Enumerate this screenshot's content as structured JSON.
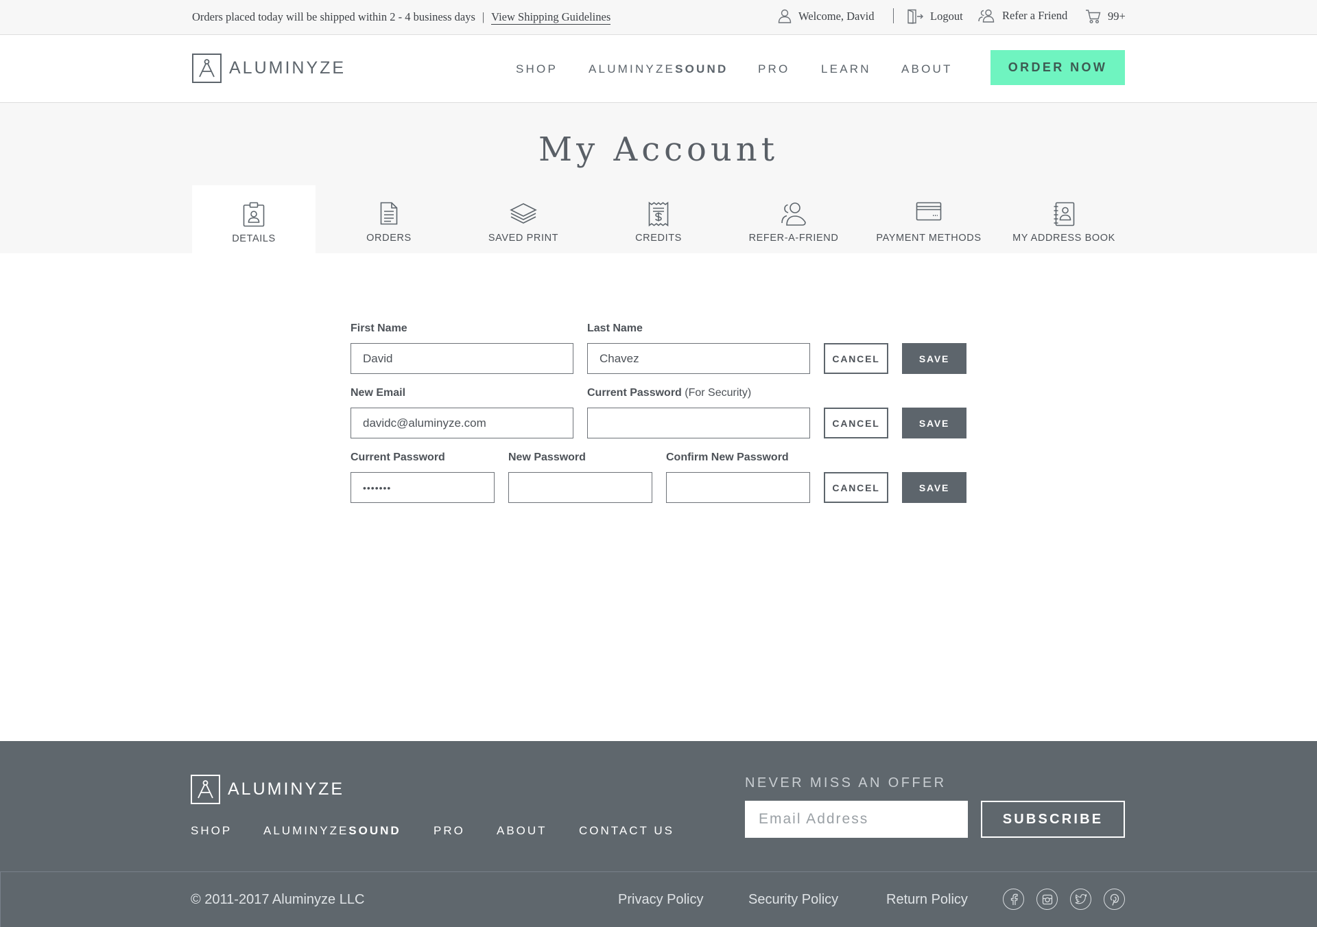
{
  "topbar": {
    "shipping_message": "Orders placed today will be shipped within 2 - 4 business days",
    "separator": "|",
    "shipping_link": "View Shipping Guidelines",
    "welcome": "Welcome, David",
    "logout": "Logout",
    "refer": "Refer a Friend",
    "cart_count": "99+"
  },
  "header": {
    "logo_text": "ALUMINYZE",
    "nav": {
      "shop": "SHOP",
      "sound_prefix": "ALUMINYZE",
      "sound_suffix": "SOUND",
      "pro": "PRO",
      "learn": "LEARN",
      "about": "ABOUT"
    },
    "order_now": "ORDER NOW",
    "accent_color": "#6ff4c0"
  },
  "page": {
    "title": "My Account"
  },
  "tabs": [
    {
      "label": "DETAILS",
      "icon": "id-badge-icon",
      "active": true
    },
    {
      "label": "ORDERS",
      "icon": "document-icon",
      "active": false
    },
    {
      "label": "SAVED PRINT",
      "icon": "layers-icon",
      "active": false
    },
    {
      "label": "CREDITS",
      "icon": "receipt-dollar-icon",
      "active": false
    },
    {
      "label": "REFER-A-FRIEND",
      "icon": "users-icon",
      "active": false
    },
    {
      "label": "PAYMENT METHODS",
      "icon": "credit-card-icon",
      "active": false
    },
    {
      "label": "MY ADDRESS BOOK",
      "icon": "address-book-icon",
      "active": false
    }
  ],
  "form": {
    "name_row": {
      "first_label": "First Name",
      "first_value": "David",
      "last_label": "Last Name",
      "last_value": "Chavez"
    },
    "email_row": {
      "email_label": "New Email",
      "email_value": "davidc@aluminyze.com",
      "password_label": "Current Password",
      "password_note": "(For Security)",
      "password_value": ""
    },
    "password_row": {
      "current_label": "Current Password",
      "current_value": "•••••••",
      "new_label": "New Password",
      "new_value": "",
      "confirm_label": "Confirm New Password",
      "confirm_value": ""
    },
    "cancel_label": "CANCEL",
    "save_label": "SAVE"
  },
  "footer": {
    "logo_text": "ALUMINYZE",
    "nav": {
      "shop": "SHOP",
      "sound_prefix": "ALUMINYZE",
      "sound_suffix": "SOUND",
      "pro": "PRO",
      "about": "ABOUT",
      "contact": "CONTACT US"
    },
    "offer_title": "NEVER MISS AN OFFER",
    "email_placeholder": "Email Address",
    "subscribe": "SUBSCRIBE",
    "copyright": "© 2011-2017 Aluminyze LLC",
    "policies": [
      "Privacy Policy",
      "Security Policy",
      "Return Policy"
    ],
    "social_icons": [
      "facebook-icon",
      "instagram-icon",
      "twitter-icon",
      "pinterest-icon"
    ],
    "background_color": "#5f676d"
  }
}
